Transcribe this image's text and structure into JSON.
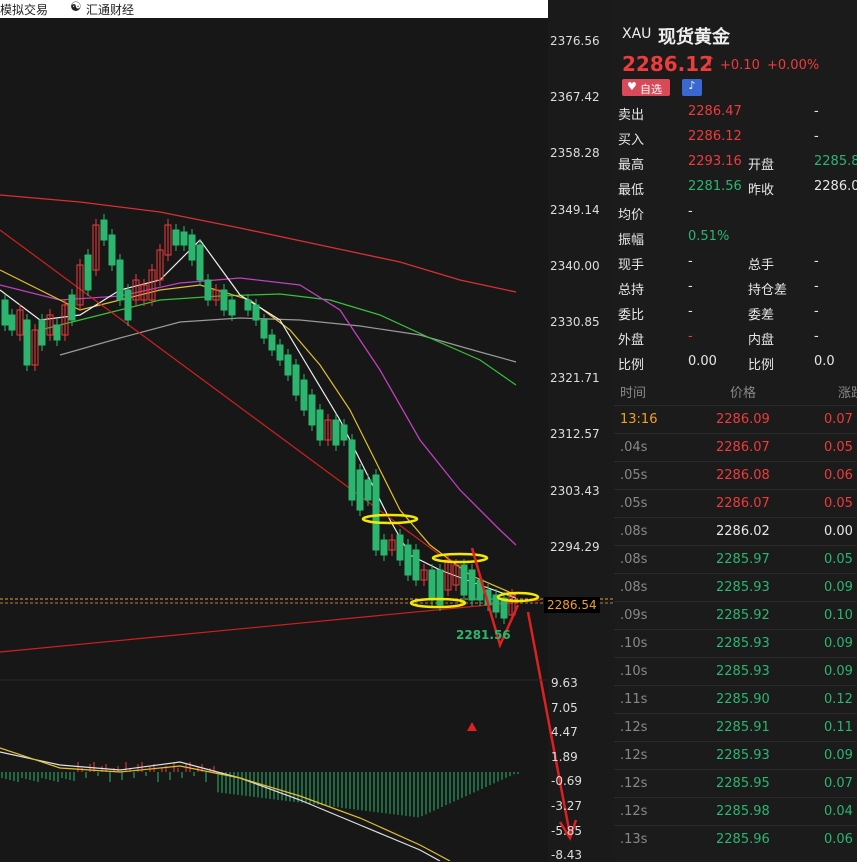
{
  "topbar": {
    "left_label": "模拟交易",
    "brand": "汇通财经"
  },
  "price_axis": [
    "2376.56",
    "2367.42",
    "2358.28",
    "2349.14",
    "2340.00",
    "2330.85",
    "2321.71",
    "2312.57",
    "2303.43",
    "2294.29"
  ],
  "current_price_tag": "2286.54",
  "low_label": "2281.56",
  "macd_axis": [
    "9.63",
    "7.05",
    "4.47",
    "1.89",
    "-0.69",
    "-3.27",
    "-5.85",
    "-8.43"
  ],
  "quote": {
    "symbol": "XAU",
    "name": "现货黄金",
    "price": "2286.12",
    "arrow": "↑",
    "change": "+0.10",
    "change_pct": "+0.00%",
    "watch_btn": "自选",
    "rows": [
      {
        "l1": "卖出",
        "v1": "2286.47",
        "v1c": "red",
        "l2": "",
        "v2": "-",
        "v2c": "white"
      },
      {
        "l1": "买入",
        "v1": "2286.12",
        "v1c": "red",
        "l2": "",
        "v2": "-",
        "v2c": "white"
      },
      {
        "l1": "最高",
        "v1": "2293.16",
        "v1c": "red",
        "l2": "开盘",
        "v2": "2285.8",
        "v2c": "green"
      },
      {
        "l1": "最低",
        "v1": "2281.56",
        "v1c": "green",
        "l2": "昨收",
        "v2": "2286.0",
        "v2c": "white"
      },
      {
        "l1": "均价",
        "v1": "-",
        "v1c": "white",
        "l2": "",
        "v2": "",
        "v2c": "white"
      },
      {
        "l1": "振幅",
        "v1": "0.51%",
        "v1c": "green",
        "l2": "",
        "v2": "",
        "v2c": "white"
      },
      {
        "l1": "现手",
        "v1": "-",
        "v1c": "white",
        "l2": "总手",
        "v2": "-",
        "v2c": "white"
      },
      {
        "l1": "总持",
        "v1": "-",
        "v1c": "white",
        "l2": "持仓差",
        "v2": "-",
        "v2c": "white"
      },
      {
        "l1": "委比",
        "v1": "-",
        "v1c": "white",
        "l2": "委差",
        "v2": "-",
        "v2c": "white"
      },
      {
        "l1": "外盘",
        "v1": "-",
        "v1c": "red",
        "l2": "内盘",
        "v2": "-",
        "v2c": "white"
      },
      {
        "l1": "比例",
        "v1": "0.00",
        "v1c": "white",
        "l2": "比例",
        "v2": "0.0",
        "v2c": "white"
      }
    ]
  },
  "ticks": {
    "headers": {
      "time": "时间",
      "price": "价格",
      "change": "涨跌"
    },
    "rows": [
      {
        "t": "13:16",
        "p": "2286.09",
        "c": "0.07",
        "col": "red",
        "tc": "orange"
      },
      {
        "t": ".04s",
        "p": "2286.07",
        "c": "0.05",
        "col": "red",
        "tc": "gray"
      },
      {
        "t": ".05s",
        "p": "2286.08",
        "c": "0.06",
        "col": "red",
        "tc": "gray"
      },
      {
        "t": ".05s",
        "p": "2286.07",
        "c": "0.05",
        "col": "red",
        "tc": "gray"
      },
      {
        "t": ".08s",
        "p": "2286.02",
        "c": "0.00",
        "col": "white",
        "tc": "gray"
      },
      {
        "t": ".08s",
        "p": "2285.97",
        "c": "0.05",
        "col": "green",
        "tc": "gray"
      },
      {
        "t": ".08s",
        "p": "2285.93",
        "c": "0.09",
        "col": "green",
        "tc": "gray"
      },
      {
        "t": ".09s",
        "p": "2285.92",
        "c": "0.10",
        "col": "green",
        "tc": "gray"
      },
      {
        "t": ".10s",
        "p": "2285.93",
        "c": "0.09",
        "col": "green",
        "tc": "gray"
      },
      {
        "t": ".10s",
        "p": "2285.93",
        "c": "0.09",
        "col": "green",
        "tc": "gray"
      },
      {
        "t": ".11s",
        "p": "2285.90",
        "c": "0.12",
        "col": "green",
        "tc": "gray"
      },
      {
        "t": ".12s",
        "p": "2285.91",
        "c": "0.11",
        "col": "green",
        "tc": "gray"
      },
      {
        "t": ".12s",
        "p": "2285.93",
        "c": "0.09",
        "col": "green",
        "tc": "gray"
      },
      {
        "t": ".12s",
        "p": "2285.95",
        "c": "0.07",
        "col": "green",
        "tc": "gray"
      },
      {
        "t": ".12s",
        "p": "2285.98",
        "c": "0.04",
        "col": "green",
        "tc": "gray"
      },
      {
        "t": ".13s",
        "p": "2285.96",
        "c": "0.06",
        "col": "green",
        "tc": "gray"
      }
    ]
  },
  "colors": {
    "up": "#ee3b3b",
    "down": "#2cb56e",
    "accent": "#f0a020"
  }
}
